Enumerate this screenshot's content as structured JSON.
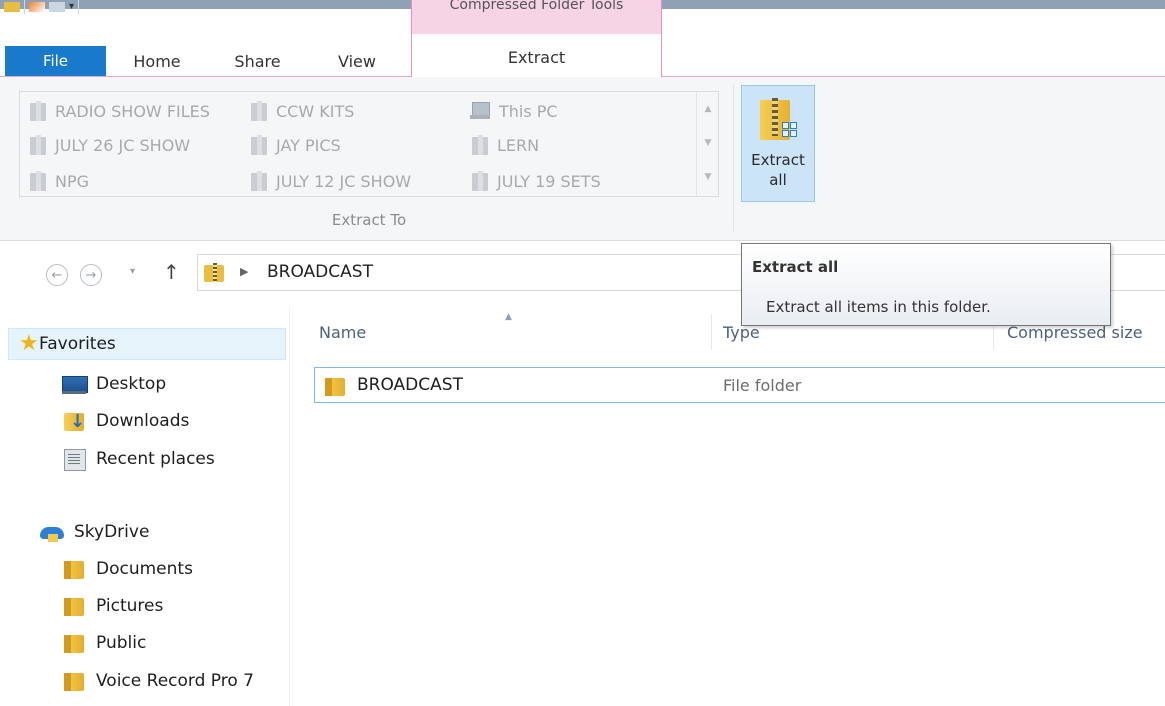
{
  "titlebar": {
    "contextual_title": "Compressed Folder Tools"
  },
  "tabs": {
    "file": "File",
    "home": "Home",
    "share": "Share",
    "view": "View",
    "extract": "Extract"
  },
  "ribbon": {
    "extract_to_items": [
      {
        "label": "RADIO SHOW FILES",
        "icon": "folder-icon"
      },
      {
        "label": "JULY 26 JC SHOW",
        "icon": "folder-icon"
      },
      {
        "label": "NPG",
        "icon": "folder-icon"
      },
      {
        "label": "CCW KITS",
        "icon": "folder-icon"
      },
      {
        "label": "JAY PICS",
        "icon": "folder-icon"
      },
      {
        "label": "JULY 12 JC SHOW",
        "icon": "folder-icon"
      },
      {
        "label": "This PC",
        "icon": "computer-icon"
      },
      {
        "label": "LERN",
        "icon": "folder-icon"
      },
      {
        "label": "JULY 19 SETS",
        "icon": "folder-icon"
      }
    ],
    "group_label": "Extract To",
    "extract_all_line1": "Extract",
    "extract_all_line2": "all"
  },
  "address": {
    "path": "BROADCAST"
  },
  "tooltip": {
    "title": "Extract all",
    "body": "Extract all items in this folder."
  },
  "navpane": {
    "favorites": "Favorites",
    "favorites_items": [
      "Desktop",
      "Downloads",
      "Recent places"
    ],
    "skydrive": "SkyDrive",
    "skydrive_items": [
      "Documents",
      "Pictures",
      "Public",
      "Voice Record Pro 7"
    ]
  },
  "filelist": {
    "columns": [
      "Name",
      "Type",
      "Compressed size"
    ],
    "rows": [
      {
        "name": "BROADCAST",
        "type": "File folder"
      }
    ]
  }
}
